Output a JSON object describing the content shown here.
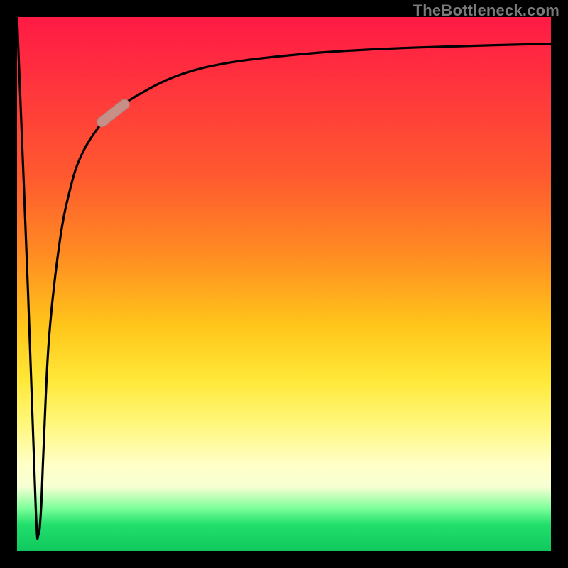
{
  "watermark": "TheBottleneck.com",
  "colors": {
    "frame": "#000000",
    "watermark": "#7a7a7a",
    "curve": "#000000",
    "marker_fill": "#c69088",
    "marker_stroke": "#b07a72"
  },
  "chart_data": {
    "type": "line",
    "title": "",
    "xlabel": "",
    "ylabel": "",
    "xlim": [
      0,
      100
    ],
    "ylim": [
      0,
      100
    ],
    "grid": false,
    "series": [
      {
        "name": "curve",
        "x": [
          0,
          2,
          3.5,
          4,
          4.5,
          5,
          6,
          8,
          10,
          12,
          15,
          18,
          22,
          30,
          40,
          55,
          70,
          85,
          100
        ],
        "y": [
          100,
          50,
          8,
          3,
          8,
          20,
          40,
          58,
          68,
          74,
          79,
          82,
          85,
          89,
          91.5,
          93.2,
          94.1,
          94.6,
          95
        ]
      }
    ],
    "marker": {
      "x": 18,
      "y": 82,
      "angle_deg": 38,
      "length": 8
    },
    "background_gradient_stops": [
      {
        "pos": 0,
        "color": "#ff1a44"
      },
      {
        "pos": 30,
        "color": "#ff5a2f"
      },
      {
        "pos": 58,
        "color": "#ffc61a"
      },
      {
        "pos": 84,
        "color": "#ffffc8"
      },
      {
        "pos": 95,
        "color": "#22e06c"
      },
      {
        "pos": 100,
        "color": "#10c85e"
      }
    ]
  }
}
